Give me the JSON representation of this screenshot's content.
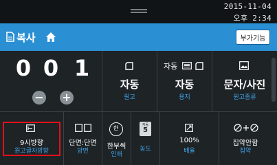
{
  "status": {
    "date": "2015-11-04",
    "time": "오후 2:34"
  },
  "header": {
    "title": "복사",
    "extra_button": "부가기능"
  },
  "counter": {
    "digits": [
      "0",
      "0",
      "1"
    ],
    "minus": "−",
    "plus": "+"
  },
  "tiles_top": [
    {
      "main": "자동",
      "sub": "원고",
      "icon": "original-icon"
    },
    {
      "top_label": "자동",
      "main": "자동",
      "sub": "용지",
      "icon": "paper-tray-icon"
    },
    {
      "main": "문자/사진",
      "sub": "원고종류",
      "icon": "image-icon"
    }
  ],
  "tiles_bottom": [
    {
      "main": "9시방향",
      "sub": "원고글자방향",
      "icon": "orientation-icon"
    },
    {
      "main": "단면:단면",
      "sub": "양면",
      "icon": "duplex-icon"
    },
    {
      "main": "한부씩",
      "sub": "인쇄",
      "icon": "collate-icon",
      "badge": "한"
    },
    {
      "main": "",
      "sub": "농도",
      "icon": "density-icon",
      "badge_top": "자동",
      "badge": "5"
    },
    {
      "main": "100%",
      "sub": "배율",
      "icon": "zoom-icon"
    },
    {
      "main": "집약안함",
      "sub": "집약",
      "icon": "combine-icon"
    }
  ]
}
